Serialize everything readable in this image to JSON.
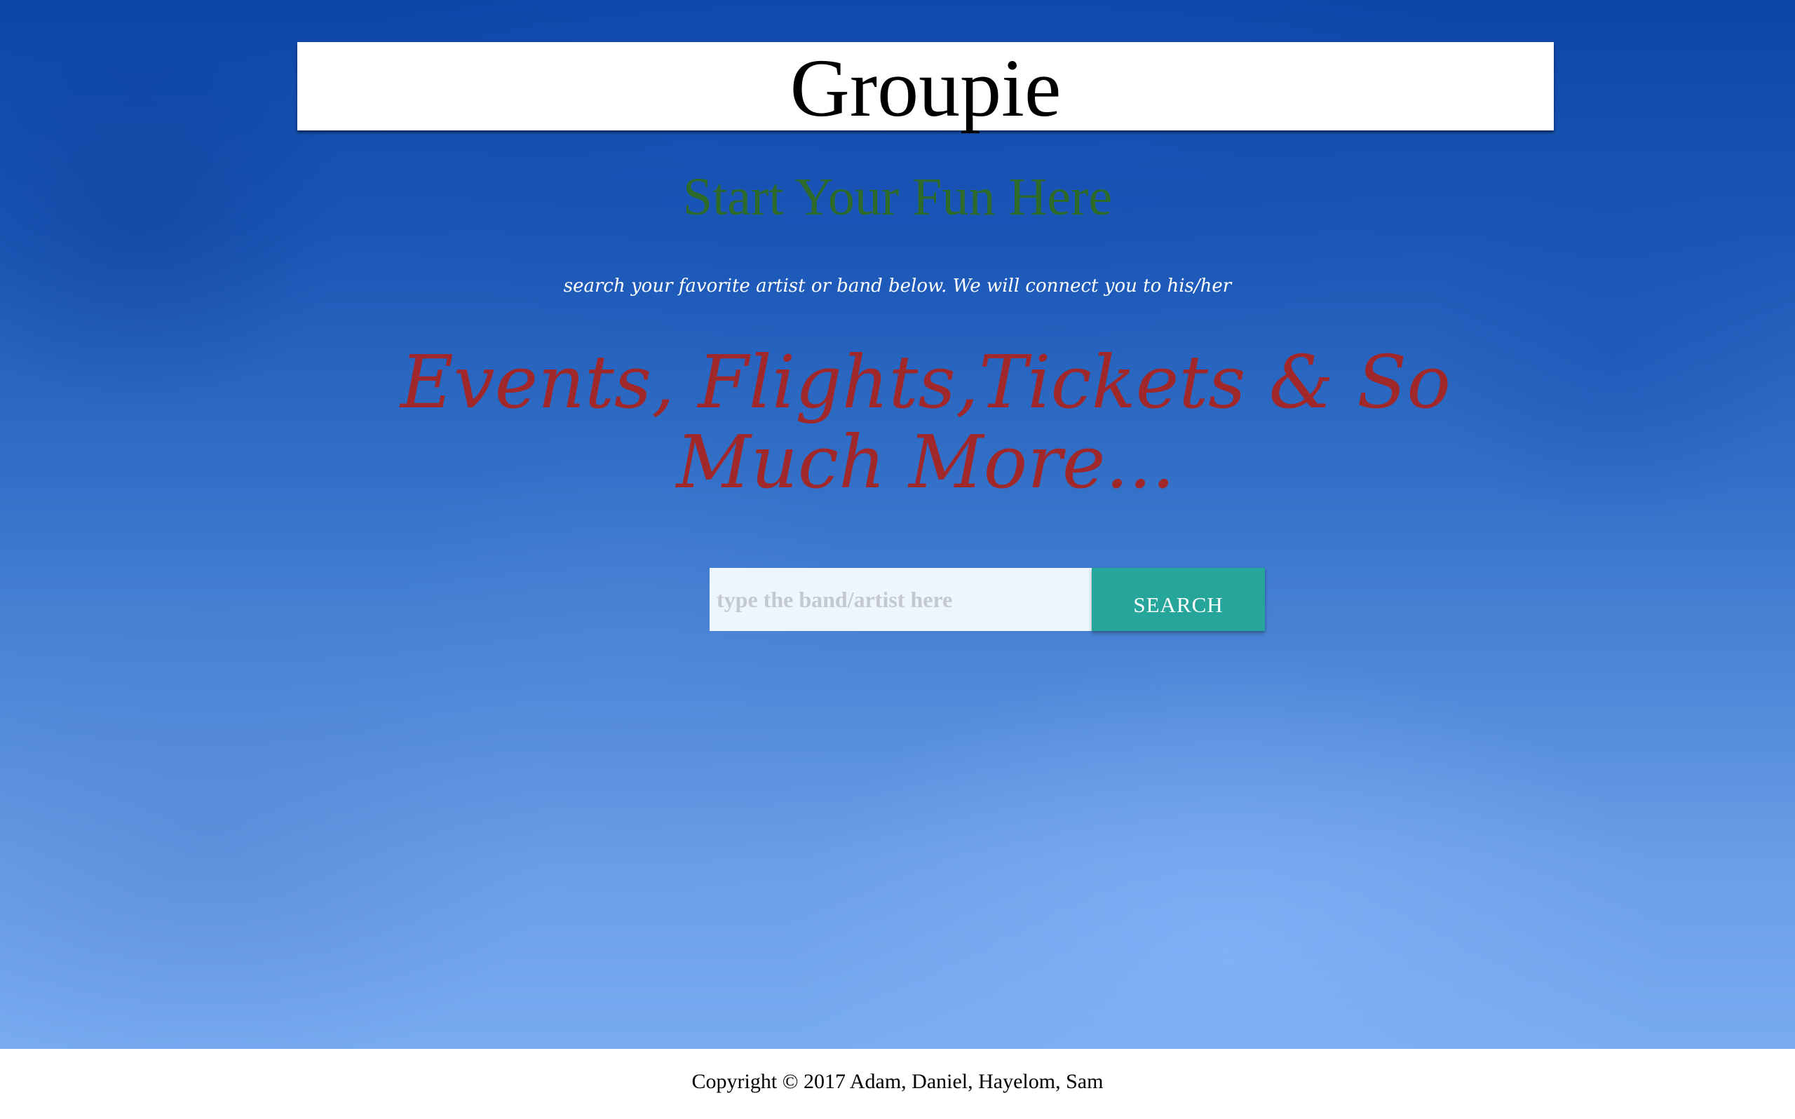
{
  "header": {
    "title": "Groupie"
  },
  "hero": {
    "tagline": "Start Your Fun Here",
    "instruction": "search your favorite artist or band below. We will connect you to his/her",
    "promo": "Events, Flights,Tickets & So Much More..."
  },
  "search": {
    "placeholder": "type the band/artist here",
    "value": "",
    "button_label": "Search"
  },
  "footer": {
    "copyright": "Copyright © 2017 Adam, Daniel, Hayelom, Sam"
  },
  "colors": {
    "title_bar": "#ffffff",
    "tagline": "#2e6b2a",
    "promo": "#a0282a",
    "search_button": "#26a69a",
    "background_top": "#0c47a8",
    "background_bottom": "#78abf0"
  }
}
